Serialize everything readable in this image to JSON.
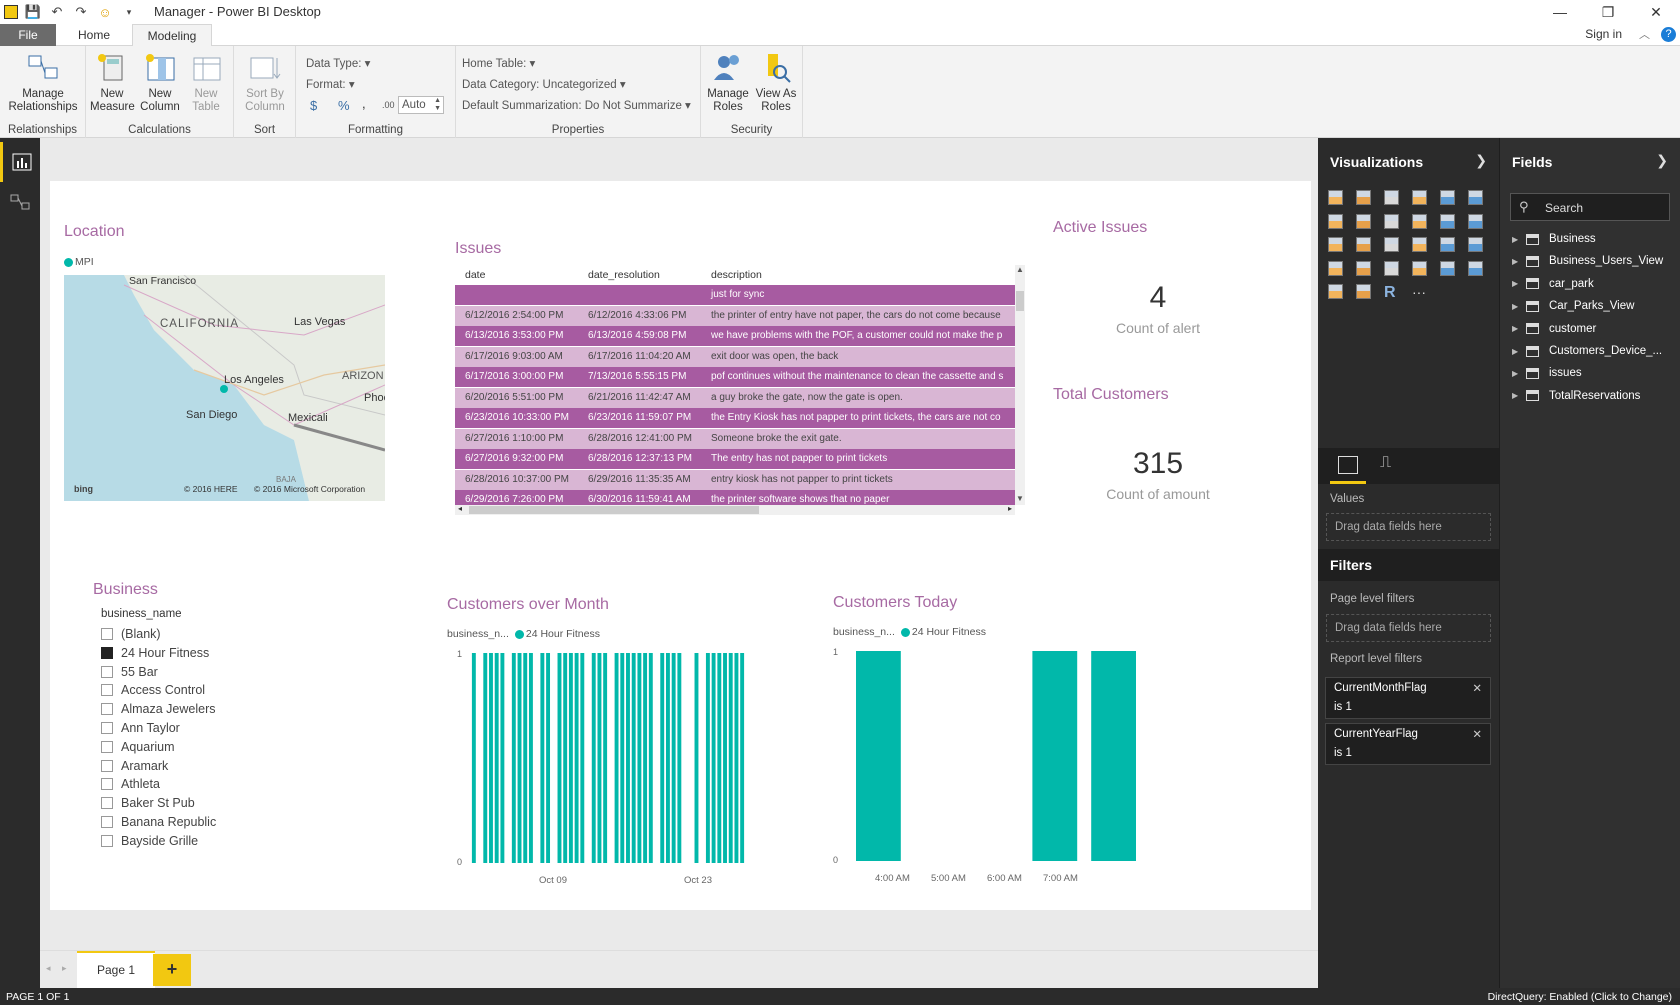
{
  "app": {
    "title": "Manager - Power BI Desktop",
    "sign_in": "Sign in",
    "help": "?"
  },
  "ribbon_tabs": {
    "file": "File",
    "home": "Home",
    "modeling": "Modeling"
  },
  "ribbon": {
    "relationships": {
      "manage": "Manage Relationships",
      "group": "Relationships"
    },
    "calculations": {
      "new_measure": "New Measure",
      "new_column": "New Column",
      "new_table": "New Table",
      "group": "Calculations"
    },
    "sort": {
      "sort_by_column": "Sort By Column",
      "group": "Sort"
    },
    "formatting": {
      "data_type": "Data Type:",
      "format": "Format:",
      "currency": "$",
      "percent": "%",
      "comma": ",",
      "decimals": ".00",
      "auto": "Auto",
      "group": "Formatting"
    },
    "properties": {
      "home_table": "Home Table:",
      "data_category": "Data Category: Uncategorized",
      "default_summarization": "Default Summarization: Do Not Summarize",
      "group": "Properties"
    },
    "security": {
      "manage_roles": "Manage Roles",
      "view_as_roles": "View As Roles",
      "group": "Security"
    }
  },
  "location": {
    "title": "Location",
    "legend": "MPI",
    "map_labels": [
      "San Francisco",
      "CALIFORNIA",
      "Las Vegas",
      "Los Angeles",
      "ARIZON",
      "San Diego",
      "Mexicali",
      "Phoe",
      "BAJA"
    ],
    "bing": "bing",
    "credit_here": "© 2016 HERE",
    "credit_ms": "© 2016 Microsoft Corporation"
  },
  "issues": {
    "title": "Issues",
    "columns": [
      "date",
      "date_resolution",
      "description"
    ],
    "rows": [
      {
        "date": "",
        "resolution": "",
        "description": "just for sync"
      },
      {
        "date": "6/12/2016 2:54:00 PM",
        "resolution": "6/12/2016 4:33:06 PM",
        "description": "the printer of entry have not paper, the cars do not come because"
      },
      {
        "date": "6/13/2016 3:53:00 PM",
        "resolution": "6/13/2016 4:59:08 PM",
        "description": "we have problems with the POF, a customer could not make the p"
      },
      {
        "date": "6/17/2016 9:03:00 AM",
        "resolution": "6/17/2016 11:04:20 AM",
        "description": "exit door was open, the back"
      },
      {
        "date": "6/17/2016 3:00:00 PM",
        "resolution": "7/13/2016 5:55:15 PM",
        "description": "pof continues without the maintenance to clean the cassette and s"
      },
      {
        "date": "6/20/2016 5:51:00 PM",
        "resolution": "6/21/2016 11:42:47 AM",
        "description": "a guy broke the gate, now the gate is open."
      },
      {
        "date": "6/23/2016 10:33:00 PM",
        "resolution": "6/23/2016 11:59:07 PM",
        "description": "the Entry Kiosk has not papper to print tickets, the cars are not co"
      },
      {
        "date": "6/27/2016 1:10:00 PM",
        "resolution": "6/28/2016 12:41:00 PM",
        "description": "Someone broke the exit gate."
      },
      {
        "date": "6/27/2016 9:32:00 PM",
        "resolution": "6/28/2016 12:37:13 PM",
        "description": "The entry has not papper to print tickets"
      },
      {
        "date": "6/28/2016 10:37:00 PM",
        "resolution": "6/29/2016 11:35:35 AM",
        "description": "entry kiosk has not papper to print tickets"
      },
      {
        "date": "6/29/2016 7:26:00 PM",
        "resolution": "6/30/2016 11:59:41 AM",
        "description": "the printer software shows that no paper"
      }
    ]
  },
  "active_issues": {
    "title": "Active Issues",
    "value": "4",
    "label": "Count of alert"
  },
  "total_customers": {
    "title": "Total Customers",
    "value": "315",
    "label": "Count of amount"
  },
  "business": {
    "title": "Business",
    "field": "business_name",
    "items": [
      {
        "label": "(Blank)",
        "checked": false
      },
      {
        "label": "24 Hour Fitness",
        "checked": true
      },
      {
        "label": "55 Bar",
        "checked": false
      },
      {
        "label": "Access Control",
        "checked": false
      },
      {
        "label": "Almaza Jewelers",
        "checked": false
      },
      {
        "label": "Ann Taylor",
        "checked": false
      },
      {
        "label": "Aquarium",
        "checked": false
      },
      {
        "label": "Aramark",
        "checked": false
      },
      {
        "label": "Athleta",
        "checked": false
      },
      {
        "label": "Baker St Pub",
        "checked": false
      },
      {
        "label": "Banana Republic",
        "checked": false
      },
      {
        "label": "Bayside Grille",
        "checked": false
      }
    ]
  },
  "chart_data": [
    {
      "type": "bar",
      "title": "Customers over Month",
      "legend_title": "business_n...",
      "series": [
        {
          "name": "24 Hour Fitness",
          "color": "#01b8aa"
        }
      ],
      "ylim": [
        0,
        1
      ],
      "y_ticks": [
        "1",
        "0"
      ],
      "x_ticks": [
        "Oct 09",
        "Oct 23"
      ],
      "bars": [
        1,
        0,
        1,
        1,
        1,
        1,
        0,
        1,
        1,
        1,
        1,
        0,
        1,
        1,
        0,
        1,
        1,
        1,
        1,
        1,
        0,
        1,
        1,
        1,
        0,
        1,
        1,
        1,
        1,
        1,
        1,
        1,
        0,
        1,
        1,
        1,
        1,
        0,
        0,
        1,
        0,
        1,
        1,
        1,
        1,
        1,
        1,
        1
      ]
    },
    {
      "type": "bar",
      "title": "Customers Today",
      "legend_title": "business_n...",
      "series": [
        {
          "name": "24 Hour Fitness",
          "color": "#01b8aa"
        }
      ],
      "ylim": [
        0,
        1
      ],
      "y_ticks": [
        "1",
        "0"
      ],
      "x_ticks": [
        "4:00 AM",
        "5:00 AM",
        "6:00 AM",
        "7:00 AM"
      ],
      "bars": [
        1,
        0,
        0,
        1,
        1
      ]
    }
  ],
  "pages": {
    "current": "Page 1",
    "add": "+",
    "status": "PAGE 1 OF 1",
    "directquery": "DirectQuery: Enabled (Click to Change)"
  },
  "visualizations": {
    "title": "Visualizations",
    "values_label": "Values",
    "drop_hint": "Drag data fields here"
  },
  "filters": {
    "title": "Filters",
    "page_level": "Page level filters",
    "drop_hint": "Drag data fields here",
    "report_level": "Report level filters",
    "cards": [
      {
        "field": "CurrentMonthFlag",
        "cond": "is 1"
      },
      {
        "field": "CurrentYearFlag",
        "cond": "is 1"
      }
    ]
  },
  "fields": {
    "title": "Fields",
    "search_placeholder": "Search",
    "tables": [
      "Business",
      "Business_Users_View",
      "car_park",
      "Car_Parks_View",
      "customer",
      "Customers_Device_...",
      "issues",
      "TotalReservations"
    ]
  }
}
